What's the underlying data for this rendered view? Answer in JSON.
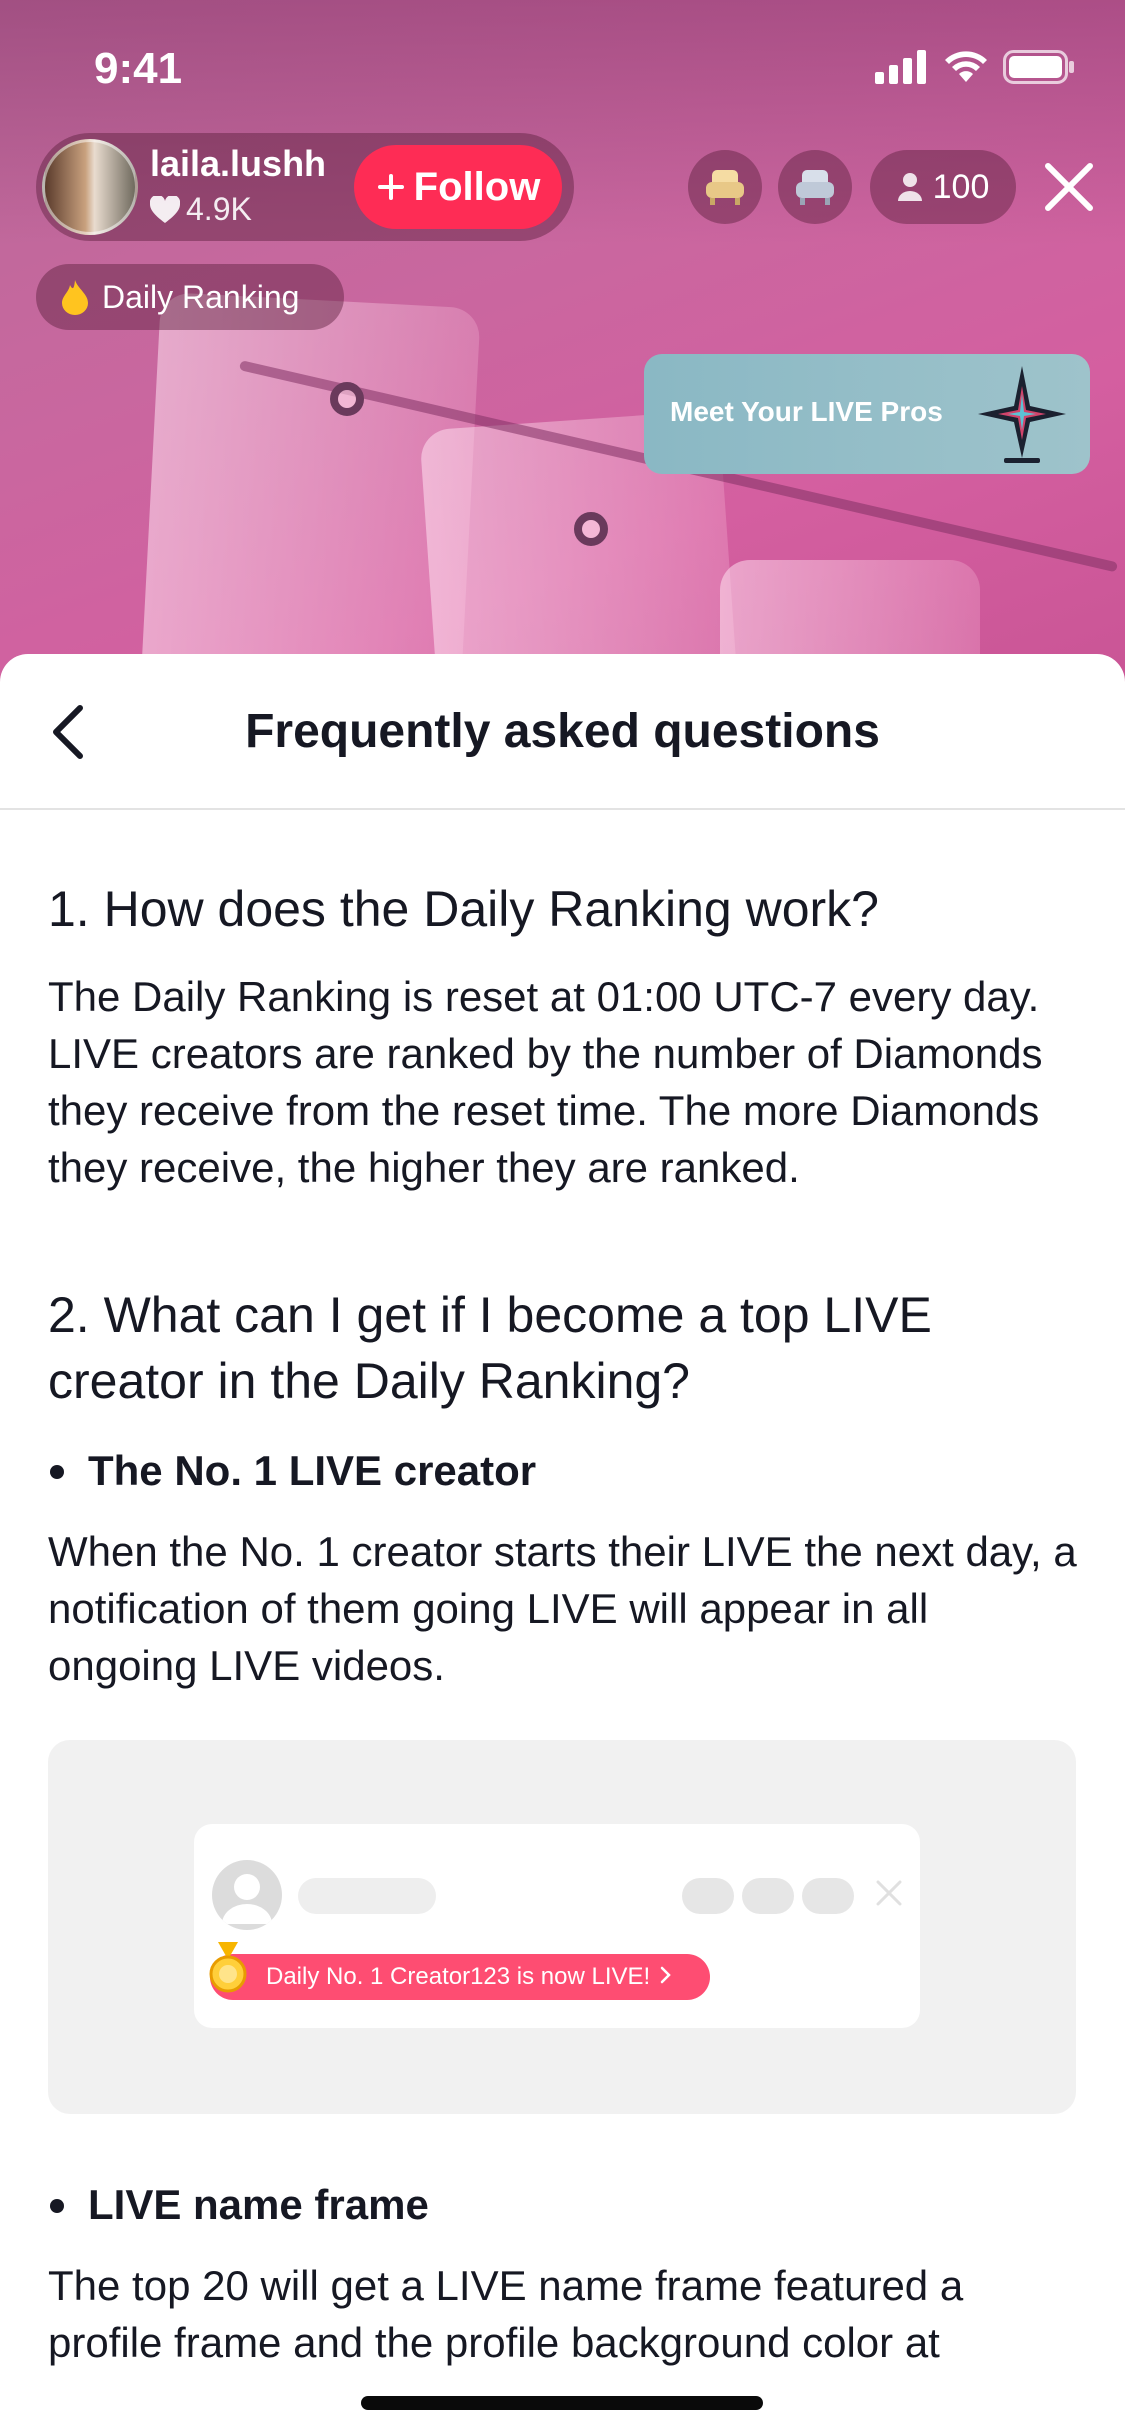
{
  "status_bar": {
    "time": "9:41"
  },
  "host": {
    "name": "laila.lushh",
    "likes": "4.9K",
    "follow_label": "Follow"
  },
  "header": {
    "viewer_count": "100"
  },
  "ranking_pill": {
    "label": "Daily Ranking"
  },
  "banner": {
    "text": "Meet Your LIVE Pros"
  },
  "sheet": {
    "title": "Frequently asked questions"
  },
  "faq": {
    "q1": {
      "title": "1. How does the Daily Ranking work?",
      "answer": "The Daily Ranking is reset at 01:00 UTC-7 every day. LIVE creators are ranked by the number of Diamonds they receive from the reset time. The more Diamonds they receive, the higher they are ranked."
    },
    "q2": {
      "title": "2. What can I get if I become a top LIVE creator in the Daily Ranking?",
      "bullet1": {
        "title": "The No. 1 LIVE creator",
        "text": "When the No. 1 creator starts their LIVE the next day, a notification of them going LIVE will appear in all ongoing LIVE videos.",
        "illustration_banner": "Daily No. 1 Creator123 is now LIVE!"
      },
      "bullet2": {
        "title": "LIVE name frame",
        "text": "The top 20 will get a LIVE name frame featured a profile frame and the profile background color at"
      }
    }
  },
  "colors": {
    "accent": "#fe2c55",
    "text": "#161823",
    "notify": "#fe4d72"
  }
}
